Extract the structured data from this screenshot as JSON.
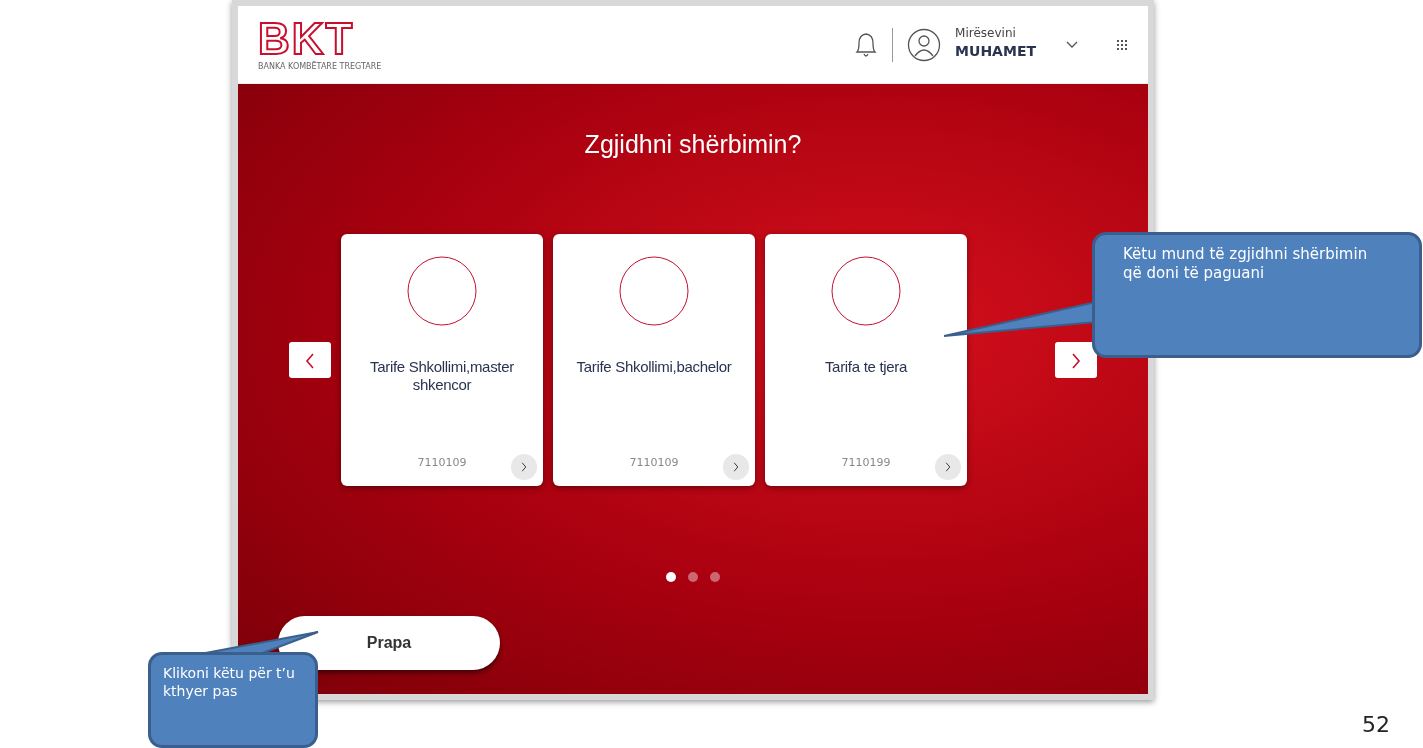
{
  "header": {
    "logo": "BKT",
    "logo_tagline": "BANKA KOMBËTARE TREGTARE",
    "greeting": "Mirësevini",
    "user_name": "MUHAMET"
  },
  "title": "Zgjidhni shërbimin?",
  "services": [
    {
      "name": "Tarife Shkollimi,master shkencor",
      "code": "7110109"
    },
    {
      "name": "Tarife Shkollimi,bachelor",
      "code": "7110109"
    },
    {
      "name": "Tarifa te tjera",
      "code": "7110199"
    }
  ],
  "pager": [
    {
      "selected": true
    },
    {
      "selected": false
    },
    {
      "selected": false
    }
  ],
  "back_button": "Prapa",
  "callouts": [
    {
      "kind": "right",
      "text": "Këtu mund të zgjidhni shërbimin që doni të paguani"
    },
    {
      "kind": "left",
      "text": "Klikoni këtu për t’u kthyer pas"
    }
  ],
  "page_number": "52"
}
